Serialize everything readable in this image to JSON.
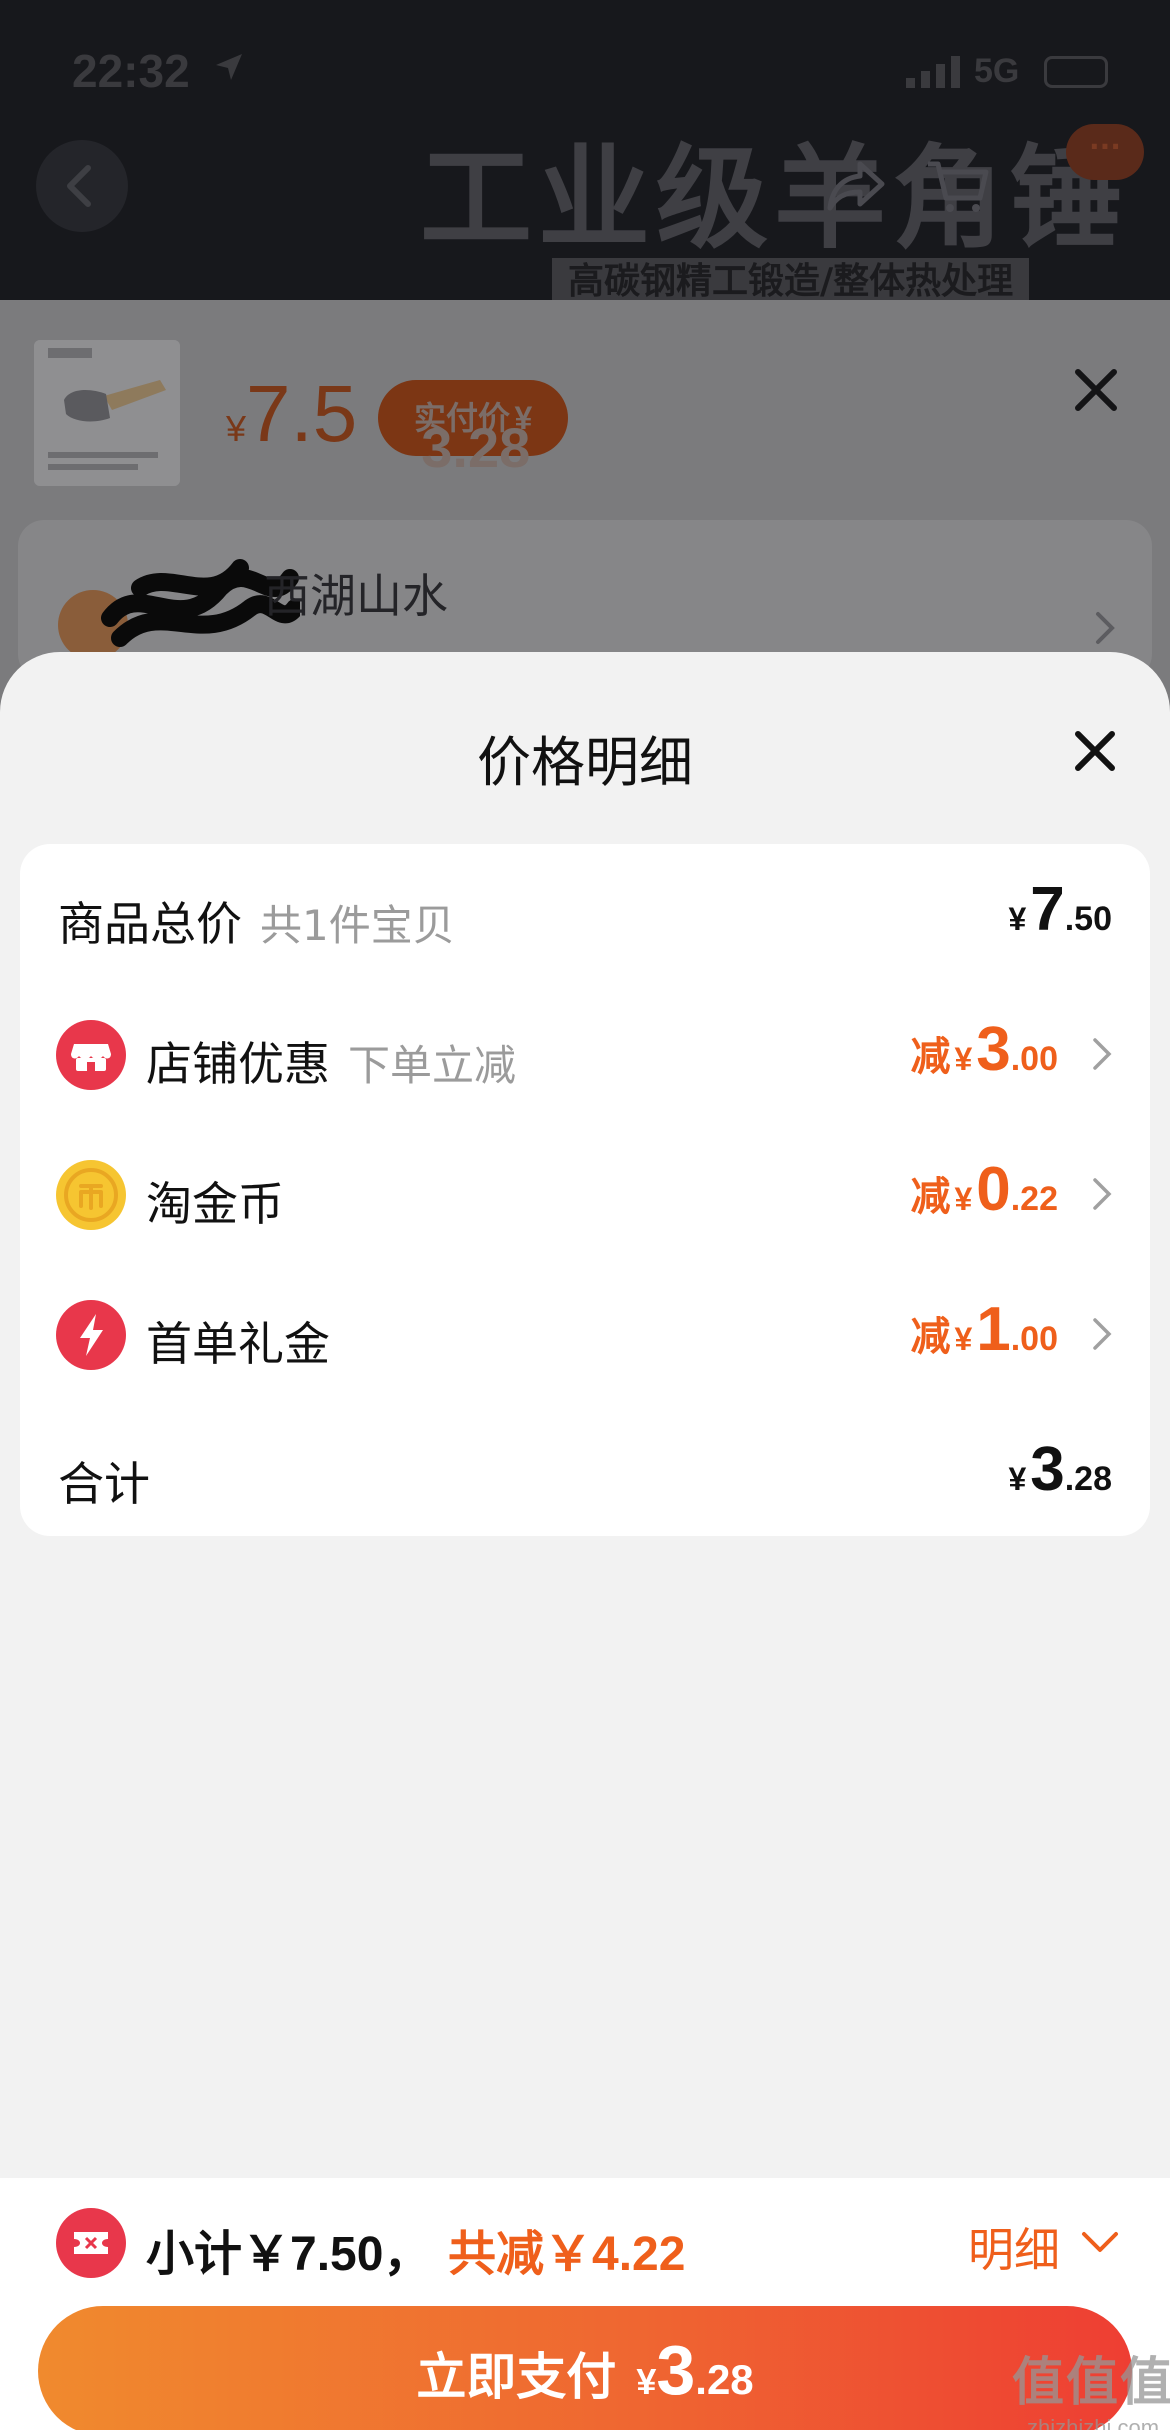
{
  "status_bar": {
    "time": "22:32",
    "network": "5G"
  },
  "background_page": {
    "banner_title": "工业级羊角锤",
    "banner_subtitle": "高碳钢精工锻造/整体热处理",
    "more_label": "···"
  },
  "sku_panel": {
    "currency": "¥",
    "price": "7.5",
    "pill_label": "实付价",
    "pill_currency": "¥",
    "pill_amount": "3.28"
  },
  "address": {
    "name": "西湖山水"
  },
  "price_detail": {
    "title": "价格明细",
    "rows": [
      {
        "label": "商品总价",
        "sub": "共1件宝贝",
        "prefix": "",
        "currency": "¥",
        "int": "7",
        "dec": ".50"
      },
      {
        "label": "店铺优惠",
        "sub": "下单立减",
        "prefix": "减",
        "currency": "¥",
        "int": "3",
        "dec": ".00",
        "icon": "store-icon",
        "color": "#e8374b"
      },
      {
        "label": "淘金币",
        "sub": "",
        "prefix": "减",
        "currency": "¥",
        "int": "0",
        "dec": ".22",
        "icon": "gold-coin-icon",
        "color": "#f6c531"
      },
      {
        "label": "首单礼金",
        "sub": "",
        "prefix": "减",
        "currency": "¥",
        "int": "1",
        "dec": ".00",
        "icon": "lightning-icon",
        "color": "#e8374b"
      },
      {
        "label": "合计",
        "sub": "",
        "prefix": "",
        "currency": "¥",
        "int": "3",
        "dec": ".28"
      }
    ]
  },
  "bottom_bar": {
    "subtotal": "小计￥7.50，",
    "total_reduce": "共减￥4.22",
    "detail_label": "明细",
    "pay_label": "立即支付",
    "pay_currency": "¥",
    "pay_int": "3",
    "pay_dec": ".28"
  },
  "watermark": {
    "main": "值值值",
    "sub": "zhizhizhi.com"
  },
  "colors": {
    "accent": "#ef5f1b",
    "brand_red": "#e8374b",
    "coin": "#f6c531"
  }
}
